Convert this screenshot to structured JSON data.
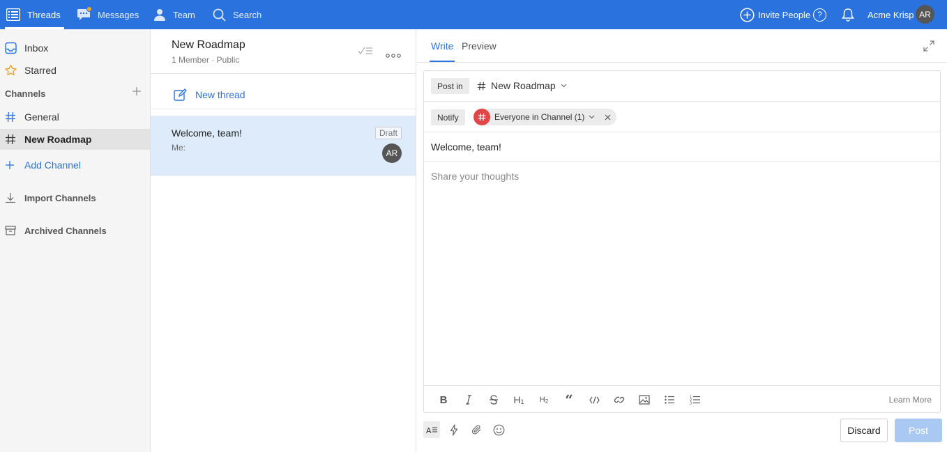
{
  "topbar": {
    "nav": [
      {
        "label": "Threads",
        "icon": "threads-icon"
      },
      {
        "label": "Messages",
        "icon": "chat-icon"
      },
      {
        "label": "Team",
        "icon": "person-icon"
      },
      {
        "label": "Search",
        "icon": "search-icon"
      }
    ],
    "invite_label": "Invite People",
    "help_label": "?",
    "workspace_name": "Acme Krisp",
    "avatar_initials": "AR",
    "accent": "#2a72de",
    "notification_dot_color": "#f5a623"
  },
  "sidebar": {
    "inbox": "Inbox",
    "starred": "Starred",
    "channels_title": "Channels",
    "channels": [
      {
        "label": "General",
        "selected": false
      },
      {
        "label": "New Roadmap",
        "selected": true
      }
    ],
    "add_channel": "Add Channel",
    "import_channels": "Import Channels",
    "archived_channels": "Archived Channels"
  },
  "middle": {
    "channel_title": "New Roadmap",
    "channel_meta": "1 Member · Public",
    "new_thread": "New thread",
    "threads": [
      {
        "title": "Welcome, team!",
        "preview": "Me:",
        "badge": "Draft",
        "avatar": "AR"
      }
    ]
  },
  "composer": {
    "tabs": [
      "Write",
      "Preview"
    ],
    "post_in_label": "Post in",
    "post_in_channel": "New Roadmap",
    "notify_label": "Notify",
    "notify_target": "Everyone in Channel (1)",
    "subject": "Welcome, team!",
    "body_placeholder": "Share your thoughts",
    "toolbar": [
      "bold",
      "italic",
      "strikethrough",
      "heading-1",
      "heading-2",
      "quote",
      "code",
      "link",
      "image",
      "bullet-list",
      "numbered-list"
    ],
    "learn_more": "Learn More",
    "discard": "Discard",
    "post": "Post"
  }
}
